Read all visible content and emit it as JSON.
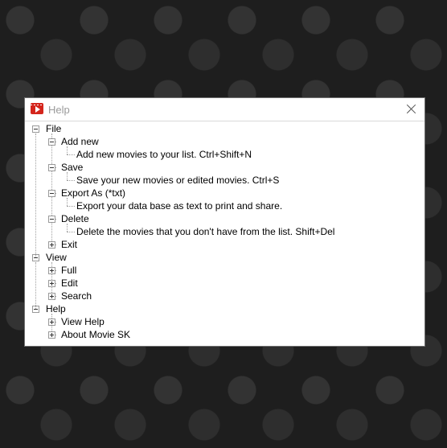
{
  "window": {
    "title": "Help",
    "icon": "movie-clapper-icon",
    "accent": "#d4251c"
  },
  "tree": [
    {
      "label": "File",
      "expanded": true,
      "children": [
        {
          "label": "Add new",
          "expanded": true,
          "children": [
            {
              "label": "Add new movies to your list. Ctrl+Shift+N"
            }
          ]
        },
        {
          "label": "Save",
          "expanded": true,
          "children": [
            {
              "label": "Save your new movies or edited movies. Ctrl+S"
            }
          ]
        },
        {
          "label": "Export As (*txt)",
          "expanded": true,
          "children": [
            {
              "label": "Export your data base as text to print and share."
            }
          ]
        },
        {
          "label": "Delete",
          "expanded": true,
          "children": [
            {
              "label": "Delete the movies that you don't have from the list. Shift+Del"
            }
          ]
        },
        {
          "label": "Exit",
          "expanded": false
        }
      ]
    },
    {
      "label": "View",
      "expanded": true,
      "children": [
        {
          "label": "Full",
          "expanded": false
        },
        {
          "label": "Edit",
          "expanded": false
        },
        {
          "label": "Search",
          "expanded": false
        }
      ]
    },
    {
      "label": "Help",
      "expanded": true,
      "children": [
        {
          "label": "View Help",
          "expanded": false
        },
        {
          "label": "About Movie SK",
          "expanded": false
        }
      ]
    }
  ]
}
